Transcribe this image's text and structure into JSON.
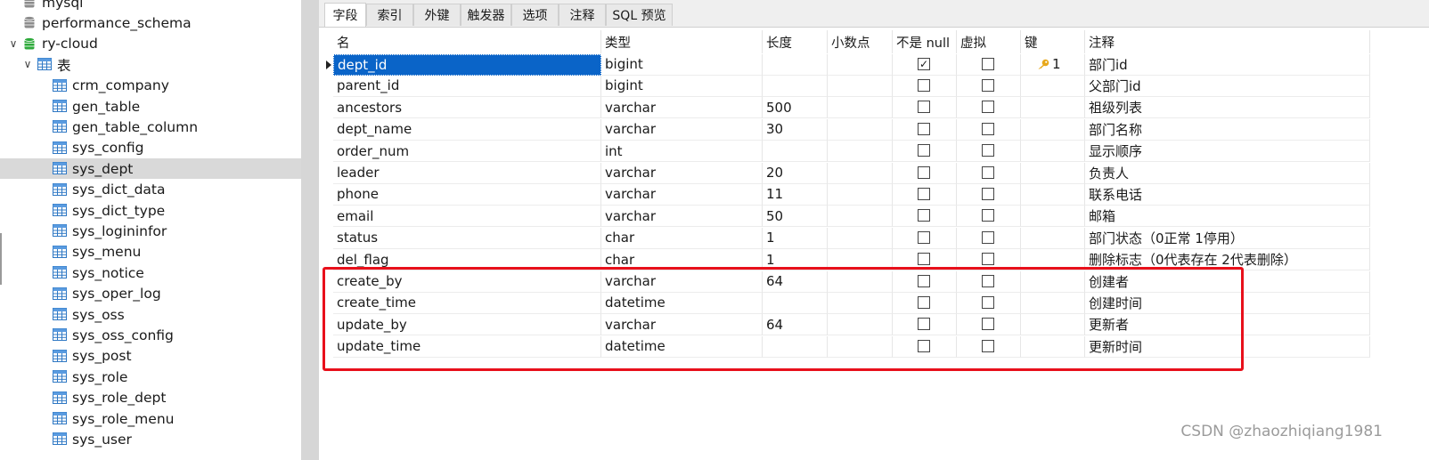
{
  "tree": {
    "items": [
      {
        "label": "mysql",
        "kind": "db",
        "level": 1,
        "expanded": false
      },
      {
        "label": "performance_schema",
        "kind": "db",
        "level": 1,
        "expanded": false
      },
      {
        "label": "ry-cloud",
        "kind": "db-active",
        "level": 1,
        "expanded": true
      },
      {
        "label": "表",
        "kind": "folder",
        "level": 2,
        "expanded": true
      },
      {
        "label": "crm_company",
        "kind": "table",
        "level": 3
      },
      {
        "label": "gen_table",
        "kind": "table",
        "level": 3
      },
      {
        "label": "gen_table_column",
        "kind": "table",
        "level": 3
      },
      {
        "label": "sys_config",
        "kind": "table",
        "level": 3
      },
      {
        "label": "sys_dept",
        "kind": "table",
        "level": 3,
        "selected": true
      },
      {
        "label": "sys_dict_data",
        "kind": "table",
        "level": 3
      },
      {
        "label": "sys_dict_type",
        "kind": "table",
        "level": 3
      },
      {
        "label": "sys_logininfor",
        "kind": "table",
        "level": 3
      },
      {
        "label": "sys_menu",
        "kind": "table",
        "level": 3
      },
      {
        "label": "sys_notice",
        "kind": "table",
        "level": 3
      },
      {
        "label": "sys_oper_log",
        "kind": "table",
        "level": 3
      },
      {
        "label": "sys_oss",
        "kind": "table",
        "level": 3
      },
      {
        "label": "sys_oss_config",
        "kind": "table",
        "level": 3
      },
      {
        "label": "sys_post",
        "kind": "table",
        "level": 3
      },
      {
        "label": "sys_role",
        "kind": "table",
        "level": 3
      },
      {
        "label": "sys_role_dept",
        "kind": "table",
        "level": 3
      },
      {
        "label": "sys_role_menu",
        "kind": "table",
        "level": 3
      },
      {
        "label": "sys_user",
        "kind": "table",
        "level": 3
      }
    ]
  },
  "tabs": [
    {
      "label": "字段",
      "active": true
    },
    {
      "label": "索引"
    },
    {
      "label": "外键"
    },
    {
      "label": "触发器"
    },
    {
      "label": "选项"
    },
    {
      "label": "注释"
    },
    {
      "label": "SQL 预览"
    }
  ],
  "columns": [
    "名",
    "类型",
    "长度",
    "小数点",
    "不是 null",
    "虚拟",
    "键",
    "注释"
  ],
  "rows": [
    {
      "name": "dept_id",
      "type": "bigint",
      "length": "",
      "decimals": "",
      "not_null": true,
      "virtual": false,
      "key": "1",
      "comment": "部门id",
      "selected": true
    },
    {
      "name": "parent_id",
      "type": "bigint",
      "length": "",
      "decimals": "",
      "not_null": false,
      "virtual": false,
      "key": "",
      "comment": "父部门id"
    },
    {
      "name": "ancestors",
      "type": "varchar",
      "length": "500",
      "decimals": "",
      "not_null": false,
      "virtual": false,
      "key": "",
      "comment": "祖级列表"
    },
    {
      "name": "dept_name",
      "type": "varchar",
      "length": "30",
      "decimals": "",
      "not_null": false,
      "virtual": false,
      "key": "",
      "comment": "部门名称"
    },
    {
      "name": "order_num",
      "type": "int",
      "length": "",
      "decimals": "",
      "not_null": false,
      "virtual": false,
      "key": "",
      "comment": "显示顺序"
    },
    {
      "name": "leader",
      "type": "varchar",
      "length": "20",
      "decimals": "",
      "not_null": false,
      "virtual": false,
      "key": "",
      "comment": "负责人"
    },
    {
      "name": "phone",
      "type": "varchar",
      "length": "11",
      "decimals": "",
      "not_null": false,
      "virtual": false,
      "key": "",
      "comment": "联系电话"
    },
    {
      "name": "email",
      "type": "varchar",
      "length": "50",
      "decimals": "",
      "not_null": false,
      "virtual": false,
      "key": "",
      "comment": "邮箱"
    },
    {
      "name": "status",
      "type": "char",
      "length": "1",
      "decimals": "",
      "not_null": false,
      "virtual": false,
      "key": "",
      "comment": "部门状态（0正常 1停用）"
    },
    {
      "name": "del_flag",
      "type": "char",
      "length": "1",
      "decimals": "",
      "not_null": false,
      "virtual": false,
      "key": "",
      "comment": "删除标志（0代表存在 2代表删除）"
    },
    {
      "name": "create_by",
      "type": "varchar",
      "length": "64",
      "decimals": "",
      "not_null": false,
      "virtual": false,
      "key": "",
      "comment": "创建者"
    },
    {
      "name": "create_time",
      "type": "datetime",
      "length": "",
      "decimals": "",
      "not_null": false,
      "virtual": false,
      "key": "",
      "comment": "创建时间"
    },
    {
      "name": "update_by",
      "type": "varchar",
      "length": "64",
      "decimals": "",
      "not_null": false,
      "virtual": false,
      "key": "",
      "comment": "更新者"
    },
    {
      "name": "update_time",
      "type": "datetime",
      "length": "",
      "decimals": "",
      "not_null": false,
      "virtual": false,
      "key": "",
      "comment": "更新时间"
    }
  ],
  "watermark": "CSDN @zhaozhiqiang1981",
  "colors": {
    "selection": "#0a64c8",
    "annotation_box": "#e8101b",
    "db_active": "#2eaa3b",
    "key": "#e8a81a"
  }
}
